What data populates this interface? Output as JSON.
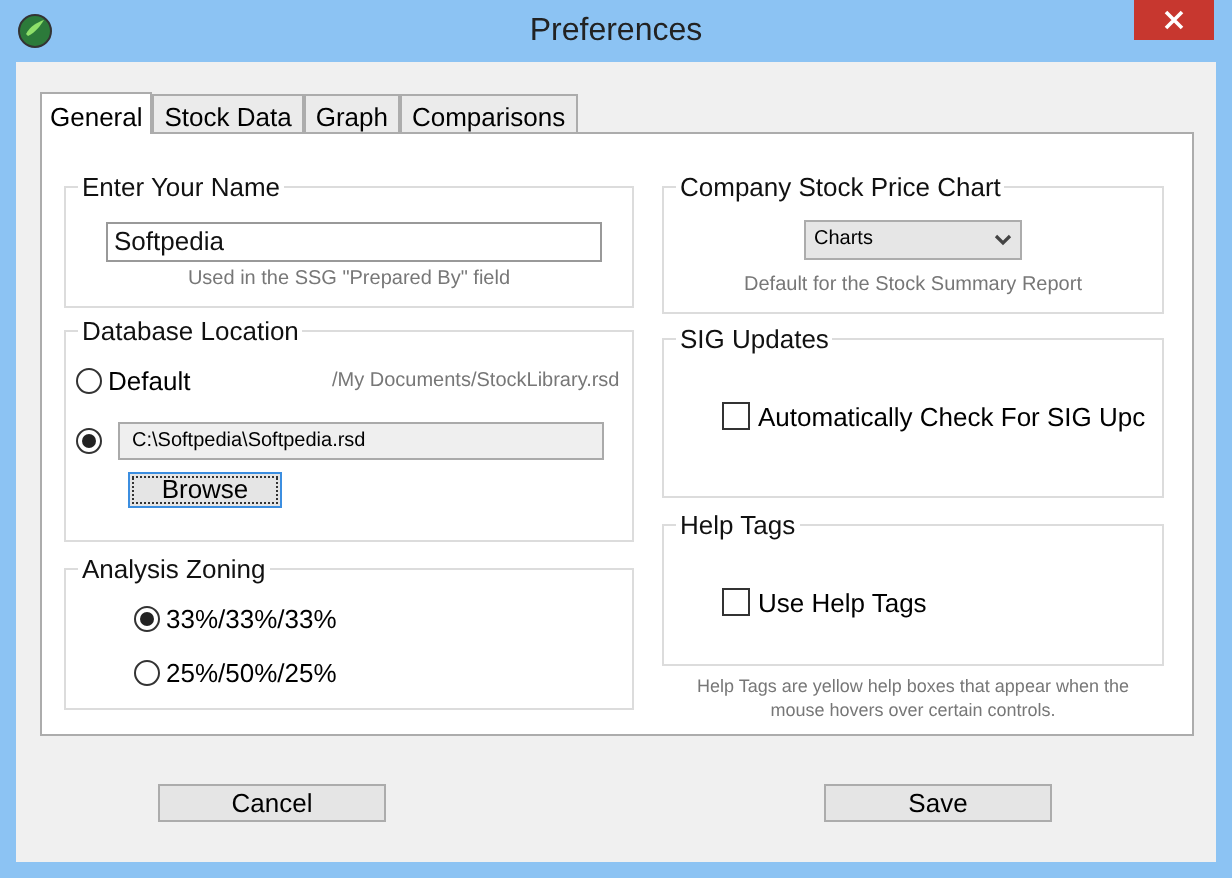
{
  "window": {
    "title": "Preferences"
  },
  "tabs": [
    {
      "label": "General",
      "selected": true
    },
    {
      "label": "Stock Data",
      "selected": false
    },
    {
      "label": "Graph",
      "selected": false
    },
    {
      "label": "Comparisons",
      "selected": false
    }
  ],
  "name_group": {
    "title": "Enter Your Name",
    "value": "Softpedia",
    "hint": "Used in the SSG \"Prepared By\" field"
  },
  "database_group": {
    "title": "Database Location",
    "options": [
      {
        "kind": "default",
        "label": "Default",
        "path": "/My Documents/StockLibrary.rsd",
        "selected": false
      },
      {
        "kind": "custom",
        "value": "C:\\Softpedia\\Softpedia.rsd",
        "selected": true
      }
    ],
    "browse_button": "Browse"
  },
  "zoning_group": {
    "title": "Analysis Zoning",
    "options": [
      {
        "label": "33%/33%/33%",
        "selected": true
      },
      {
        "label": "25%/50%/25%",
        "selected": false
      }
    ]
  },
  "chart_group": {
    "title": "Company Stock Price Chart",
    "dropdown": "Charts",
    "hint": "Default for the Stock Summary Report"
  },
  "sig_group": {
    "title": "SIG Updates",
    "checkbox": {
      "label": "Automatically Check For SIG Upc",
      "checked": false
    }
  },
  "help_group": {
    "title": "Help Tags",
    "checkbox": {
      "label": "Use Help Tags",
      "checked": false
    }
  },
  "help_note": "Help Tags are yellow help boxes that appear when the mouse hovers over certain controls.",
  "buttons": [
    "Cancel",
    "Save"
  ]
}
